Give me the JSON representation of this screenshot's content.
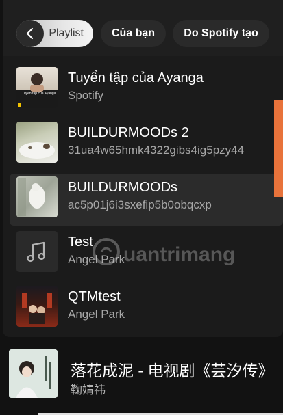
{
  "filters": {
    "back_icon": "chevron-left-icon",
    "playlist_label": "Playlist",
    "cua_ban_label": "Của bạn",
    "spotify_label": "Do Spotify tạo"
  },
  "playlists": [
    {
      "title": "Tuyển tập của Ayanga",
      "subtitle": "Spotify",
      "cover_caption": "Tuyển tập của Ayanga",
      "active": false
    },
    {
      "title": "BUILDURMOODs 2",
      "subtitle": "31ua4w65hmk4322gibs4ig5pzy44",
      "active": false
    },
    {
      "title": "BUILDURMOODs",
      "subtitle": "ac5p01j6i3sxefip5b0obqcxp",
      "active": true
    },
    {
      "title": "Test",
      "subtitle": "Angel Park",
      "cover_icon": "music-note-icon",
      "active": false
    },
    {
      "title": "QTMtest",
      "subtitle": "Angel Park",
      "active": false
    }
  ],
  "now_playing": {
    "title": "落花成泥 - 电视剧《芸汐传》",
    "artist": "鞠婧祎"
  },
  "watermark": {
    "text": "uantrimang"
  },
  "colors": {
    "scrollbar": "#e8733b",
    "background": "#1b1b1b",
    "active_row": "#2b2b2b"
  }
}
